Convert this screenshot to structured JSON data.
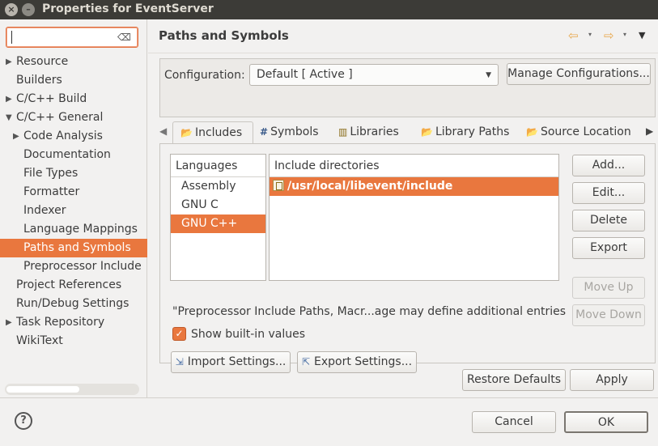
{
  "window": {
    "title": "Properties for EventServer",
    "close_glyph": "×",
    "minimize_glyph": "–"
  },
  "sidebar": {
    "filter": {
      "value": "",
      "clear_icon": "clear-icon"
    },
    "items": [
      {
        "label": "Resource",
        "level": 0,
        "expandable": true,
        "expanded": false
      },
      {
        "label": "Builders",
        "level": 0,
        "expandable": false
      },
      {
        "label": "C/C++ Build",
        "level": 0,
        "expandable": true,
        "expanded": false
      },
      {
        "label": "C/C++ General",
        "level": 0,
        "expandable": true,
        "expanded": true
      },
      {
        "label": "Code Analysis",
        "level": 1,
        "expandable": true,
        "expanded": false
      },
      {
        "label": "Documentation",
        "level": 1,
        "expandable": false
      },
      {
        "label": "File Types",
        "level": 1,
        "expandable": false
      },
      {
        "label": "Formatter",
        "level": 1,
        "expandable": false
      },
      {
        "label": "Indexer",
        "level": 1,
        "expandable": false
      },
      {
        "label": "Language Mappings",
        "level": 1,
        "expandable": false
      },
      {
        "label": "Paths and Symbols",
        "level": 1,
        "expandable": false,
        "selected": true
      },
      {
        "label": "Preprocessor Include",
        "level": 1,
        "expandable": false
      },
      {
        "label": "Project References",
        "level": 0,
        "expandable": false
      },
      {
        "label": "Run/Debug Settings",
        "level": 0,
        "expandable": false
      },
      {
        "label": "Task Repository",
        "level": 0,
        "expandable": true,
        "expanded": false
      },
      {
        "label": "WikiText",
        "level": 0,
        "expandable": false
      }
    ]
  },
  "page": {
    "title": "Paths and Symbols",
    "nav_back_glyph": "⇦",
    "nav_forward_glyph": "⇨",
    "dropdown_glyph": "▾",
    "menu_glyph": "▼"
  },
  "configuration": {
    "label": "Configuration:",
    "selected": "Default  [ Active ]",
    "manage_label": "Manage Configurations..."
  },
  "tabs": [
    {
      "label": "Includes",
      "icon": "includes-icon",
      "glyph": "📂",
      "active": true
    },
    {
      "label": "Symbols",
      "icon": "hash-icon",
      "glyph": "#",
      "active": false
    },
    {
      "label": "Libraries",
      "icon": "libraries-icon",
      "glyph": "▥",
      "active": false
    },
    {
      "label": "Library Paths",
      "icon": "library-paths-icon",
      "glyph": "📂",
      "active": false
    },
    {
      "label": "Source Location",
      "icon": "source-location-icon",
      "glyph": "📂",
      "active": false
    }
  ],
  "includes": {
    "languages_header": "Languages",
    "languages": [
      "Assembly",
      "GNU C",
      "GNU C++"
    ],
    "selected_language": "GNU C++",
    "directories_header": "Include directories",
    "directories": [
      "/usr/local/libevent/include"
    ],
    "side_buttons": {
      "add": "Add...",
      "edit": "Edit...",
      "delete": "Delete",
      "export": "Export",
      "move_up": "Move Up",
      "move_down": "Move Down"
    },
    "note": "\"Preprocessor Include Paths, Macr...age may define additional entries",
    "show_builtin_label": "Show built-in values",
    "show_builtin_checked": true,
    "import_label": "Import Settings...",
    "export_label": "Export Settings..."
  },
  "actions": {
    "restore_defaults": "Restore Defaults",
    "apply": "Apply",
    "cancel": "Cancel",
    "ok": "OK",
    "help_glyph": "?"
  },
  "colors": {
    "accent": "#e9773e",
    "titlebar": "#3c3b37"
  }
}
